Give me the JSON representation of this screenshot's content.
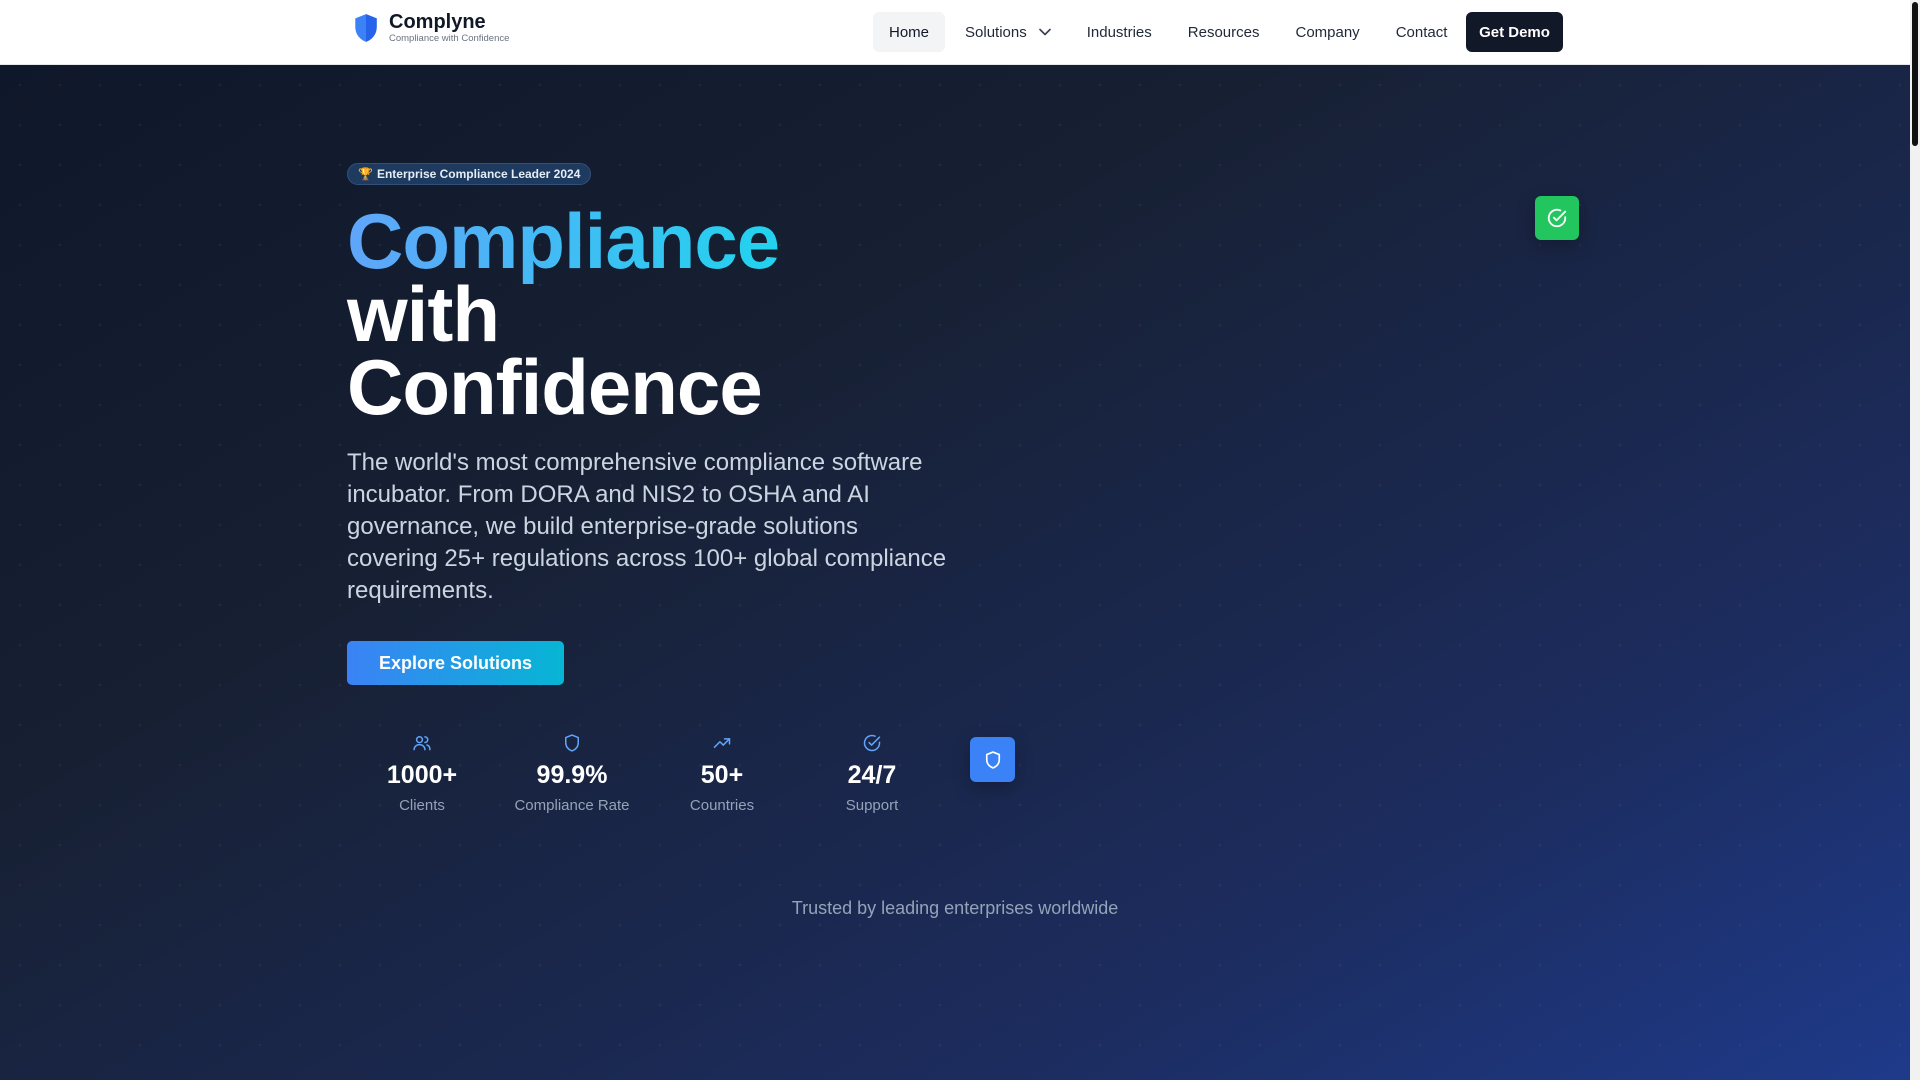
{
  "brand": {
    "name": "Complyne",
    "tagline": "Compliance with Confidence",
    "icon": "shield-icon"
  },
  "nav": {
    "items": [
      {
        "label": "Home",
        "active": true
      },
      {
        "label": "Solutions",
        "dropdown": true
      },
      {
        "label": "Industries"
      },
      {
        "label": "Resources"
      },
      {
        "label": "Company"
      },
      {
        "label": "Contact"
      }
    ],
    "cta_label": "Get Demo"
  },
  "hero": {
    "badge": "Enterprise Compliance Leader 2024",
    "badge_icon": "trophy-icon",
    "title_line1": "Compliance",
    "title_line2": "with",
    "title_line3": "Confidence",
    "lead": "The world's most comprehensive compliance software incubator. From DORA and NIS2 to OSHA and AI governance, we build enterprise-grade solutions covering 25+ regulations across 100+ global compliance requirements.",
    "cta_label": "Explore Solutions",
    "stats": [
      {
        "icon": "users-icon",
        "value": "1000+",
        "label": "Clients"
      },
      {
        "icon": "shield-icon",
        "value": "99.9%",
        "label": "Compliance Rate"
      },
      {
        "icon": "trending-up-icon",
        "value": "50+",
        "label": "Countries"
      },
      {
        "icon": "check-circle-icon",
        "value": "24/7",
        "label": "Support"
      }
    ],
    "trusted": "Trusted by leading enterprises worldwide"
  },
  "colors": {
    "accent_blue": "#3b82f6",
    "accent_cyan": "#06b6d4",
    "success_green": "#22c55e",
    "dark": "#111827"
  }
}
